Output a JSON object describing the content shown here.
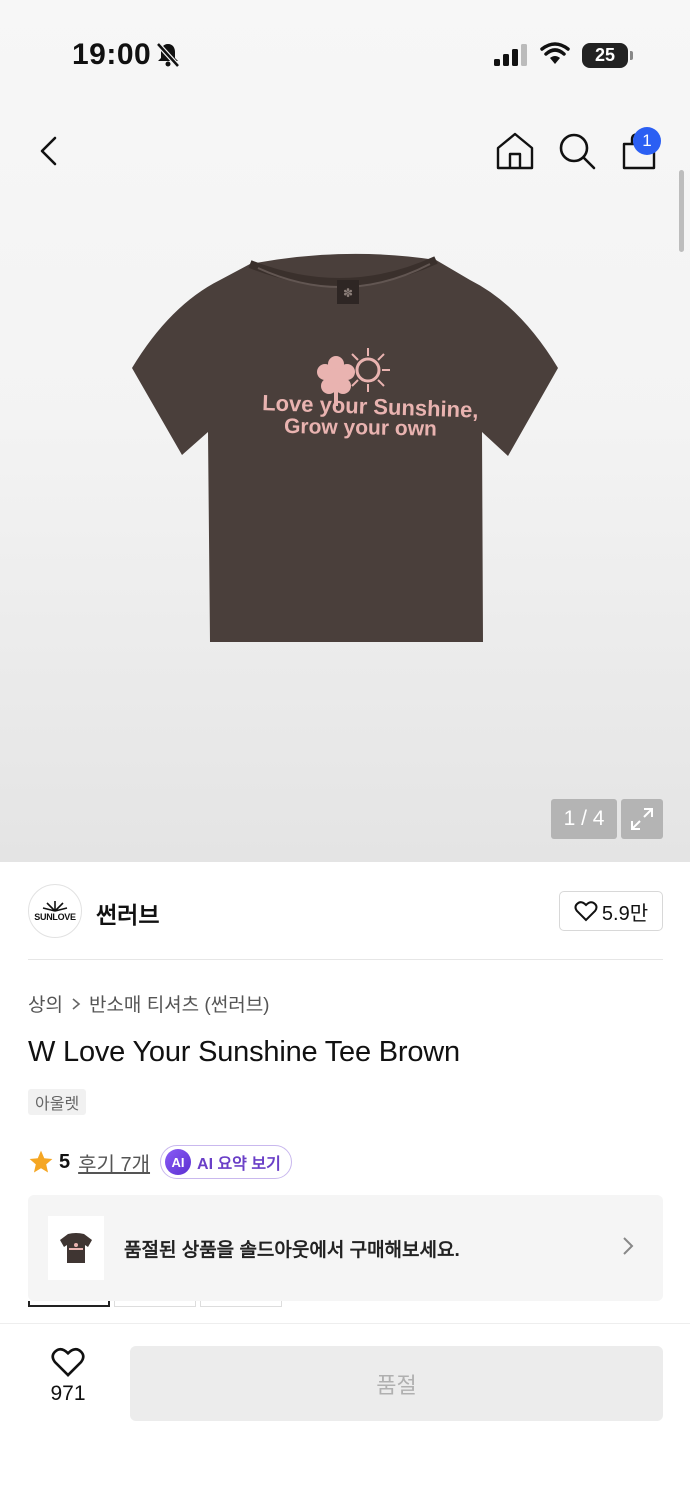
{
  "status_bar": {
    "time": "19:00",
    "battery": "25"
  },
  "header": {
    "cart_count": "1"
  },
  "gallery": {
    "counter": "1 / 4",
    "print_line1": "Love your Sunshine,",
    "print_line2": "Grow your own"
  },
  "brand": {
    "logo_text": "SUNLOVE",
    "name": "썬러브",
    "likes": "5.9만"
  },
  "breadcrumb": {
    "category": "상의",
    "subcategory": "반소매 티셔츠 (썬러브)"
  },
  "product": {
    "title": "W Love Your Sunshine Tee Brown",
    "tag": "아울렛",
    "rating": "5",
    "reviews": "후기 7개",
    "ai_badge": "AI",
    "ai_summary": "AI 요약 보기"
  },
  "soldout_notice": {
    "text": "품절된 상품을 솔드아웃에서 구매해보세요."
  },
  "bottom_bar": {
    "wish_count": "971",
    "cta_label": "품절"
  },
  "colors": {
    "accent_blue": "#2b5ff3",
    "star": "#f5a623",
    "ai_purple": "#6a3fc7",
    "shirt": "#4a3f3b",
    "print": "#e9b3b0"
  }
}
